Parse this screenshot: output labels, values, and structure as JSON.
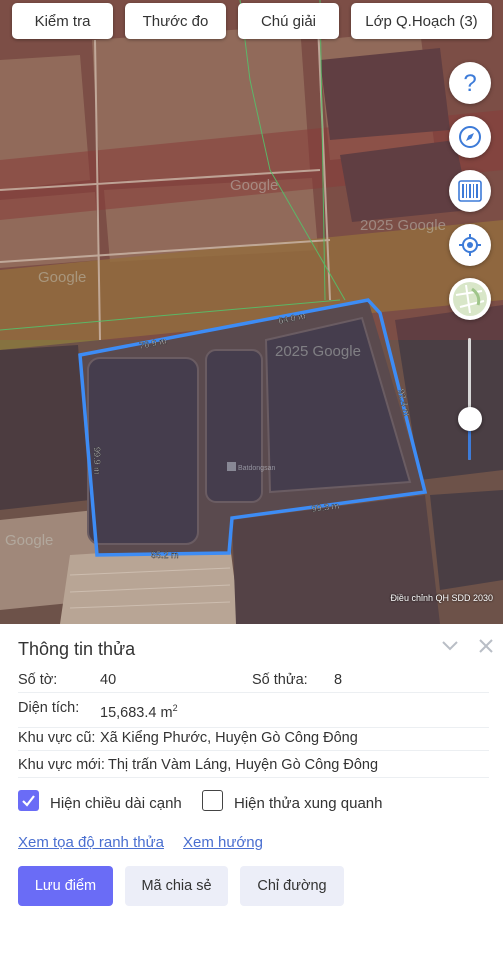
{
  "toolbar": {
    "check_label": "Kiểm tra",
    "measure_label": "Thước đo",
    "legend_label": "Chú giải",
    "layer_label": "Lớp Q.Hoạch (3)"
  },
  "map": {
    "watermarks": [
      "Google",
      "2025 Google",
      "Google",
      "Google",
      "2025 Google"
    ],
    "dims": {
      "top_left": "76.9 m",
      "top_right": "64.0 m",
      "right": "92.4 m",
      "bottom_right": "99.3 m",
      "bottom_left": "65.2 m",
      "left": "99.9 m"
    },
    "brand": "Batdongsan",
    "credit": "Điều chỉnh QH SDD 2030",
    "zoom_level": 0.34,
    "outline_color": "#3d8cf5"
  },
  "controls": [
    "help-icon",
    "compass-icon",
    "barcode-icon",
    "locate-icon",
    "map-type-icon"
  ],
  "panel": {
    "title": "Thông tin thửa",
    "sheet_label": "Số tờ:",
    "sheet_value": "40",
    "parcel_label": "Số thửa:",
    "parcel_value": "8",
    "area_label": "Diện tích:",
    "area_value": "15,683.4 m",
    "area_unit_sup": "2",
    "old_area_label": "Khu vực cũ:",
    "old_area_value": "Xã Kiểng Phước, Huyện Gò Công Đông",
    "new_area_label": "Khu vực mới:",
    "new_area_value": "Thị trấn Vàm Láng, Huyện Gò Công Đông",
    "show_edges_label": "Hiện chiều dài cạnh",
    "show_edges_checked": true,
    "show_neighbors_label": "Hiện thửa xung quanh",
    "show_neighbors_checked": false,
    "link_boundary": "Xem tọa độ ranh thửa",
    "link_direction": "Xem hướng",
    "save_label": "Lưu điểm",
    "share_label": "Mã chia sẻ",
    "route_label": "Chỉ đường",
    "accent": "#6a6cf6"
  }
}
